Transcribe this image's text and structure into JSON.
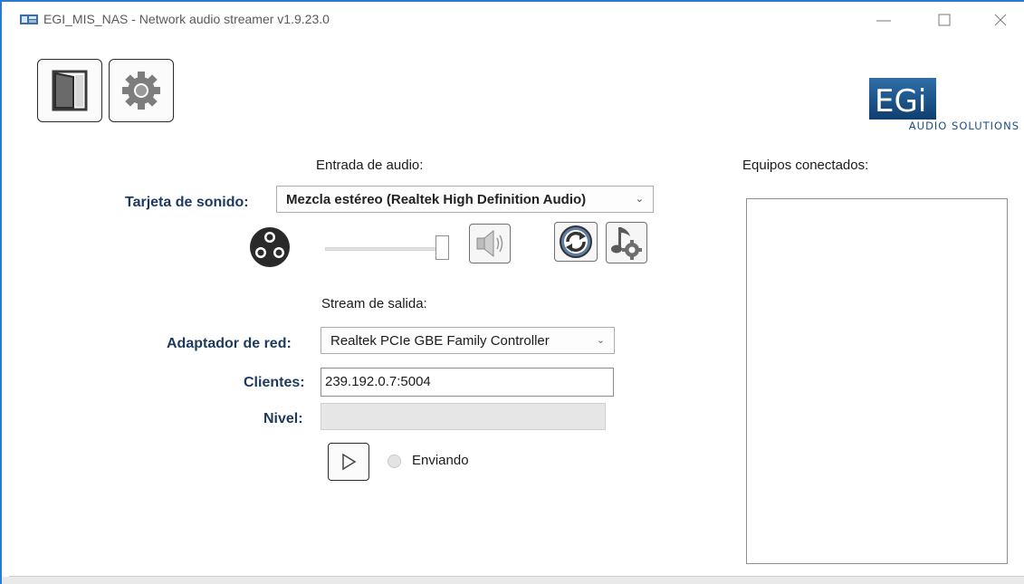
{
  "window": {
    "title": "EGI_MIS_NAS - Network audio streamer v1.9.23.0",
    "accent_color": "#2a7ad2"
  },
  "toolbar": {
    "exit_icon": "door-exit-icon",
    "settings_icon": "gear-icon",
    "logo_text": "AUDIO SOLUTIONS",
    "logo_mark": "EGi"
  },
  "audio_input": {
    "section_title": "Entrada de audio:",
    "sound_card_label": "Tarjeta de sonido:",
    "sound_card_value": "Mezcla estéreo (Realtek High Definition Audio)",
    "volume_level": 1.0
  },
  "output_stream": {
    "section_title": "Stream de salida:",
    "network_adapter_label": "Adaptador de red:",
    "network_adapter_value": "Realtek PCIe GBE Family Controller",
    "clients_label": "Clientes:",
    "clients_value": "239.192.0.7:5004",
    "level_label": "Nivel:",
    "level_value": 0,
    "sending_label": "Enviando",
    "sending": false
  },
  "connected": {
    "title": "Equipos conectados:",
    "items": []
  }
}
